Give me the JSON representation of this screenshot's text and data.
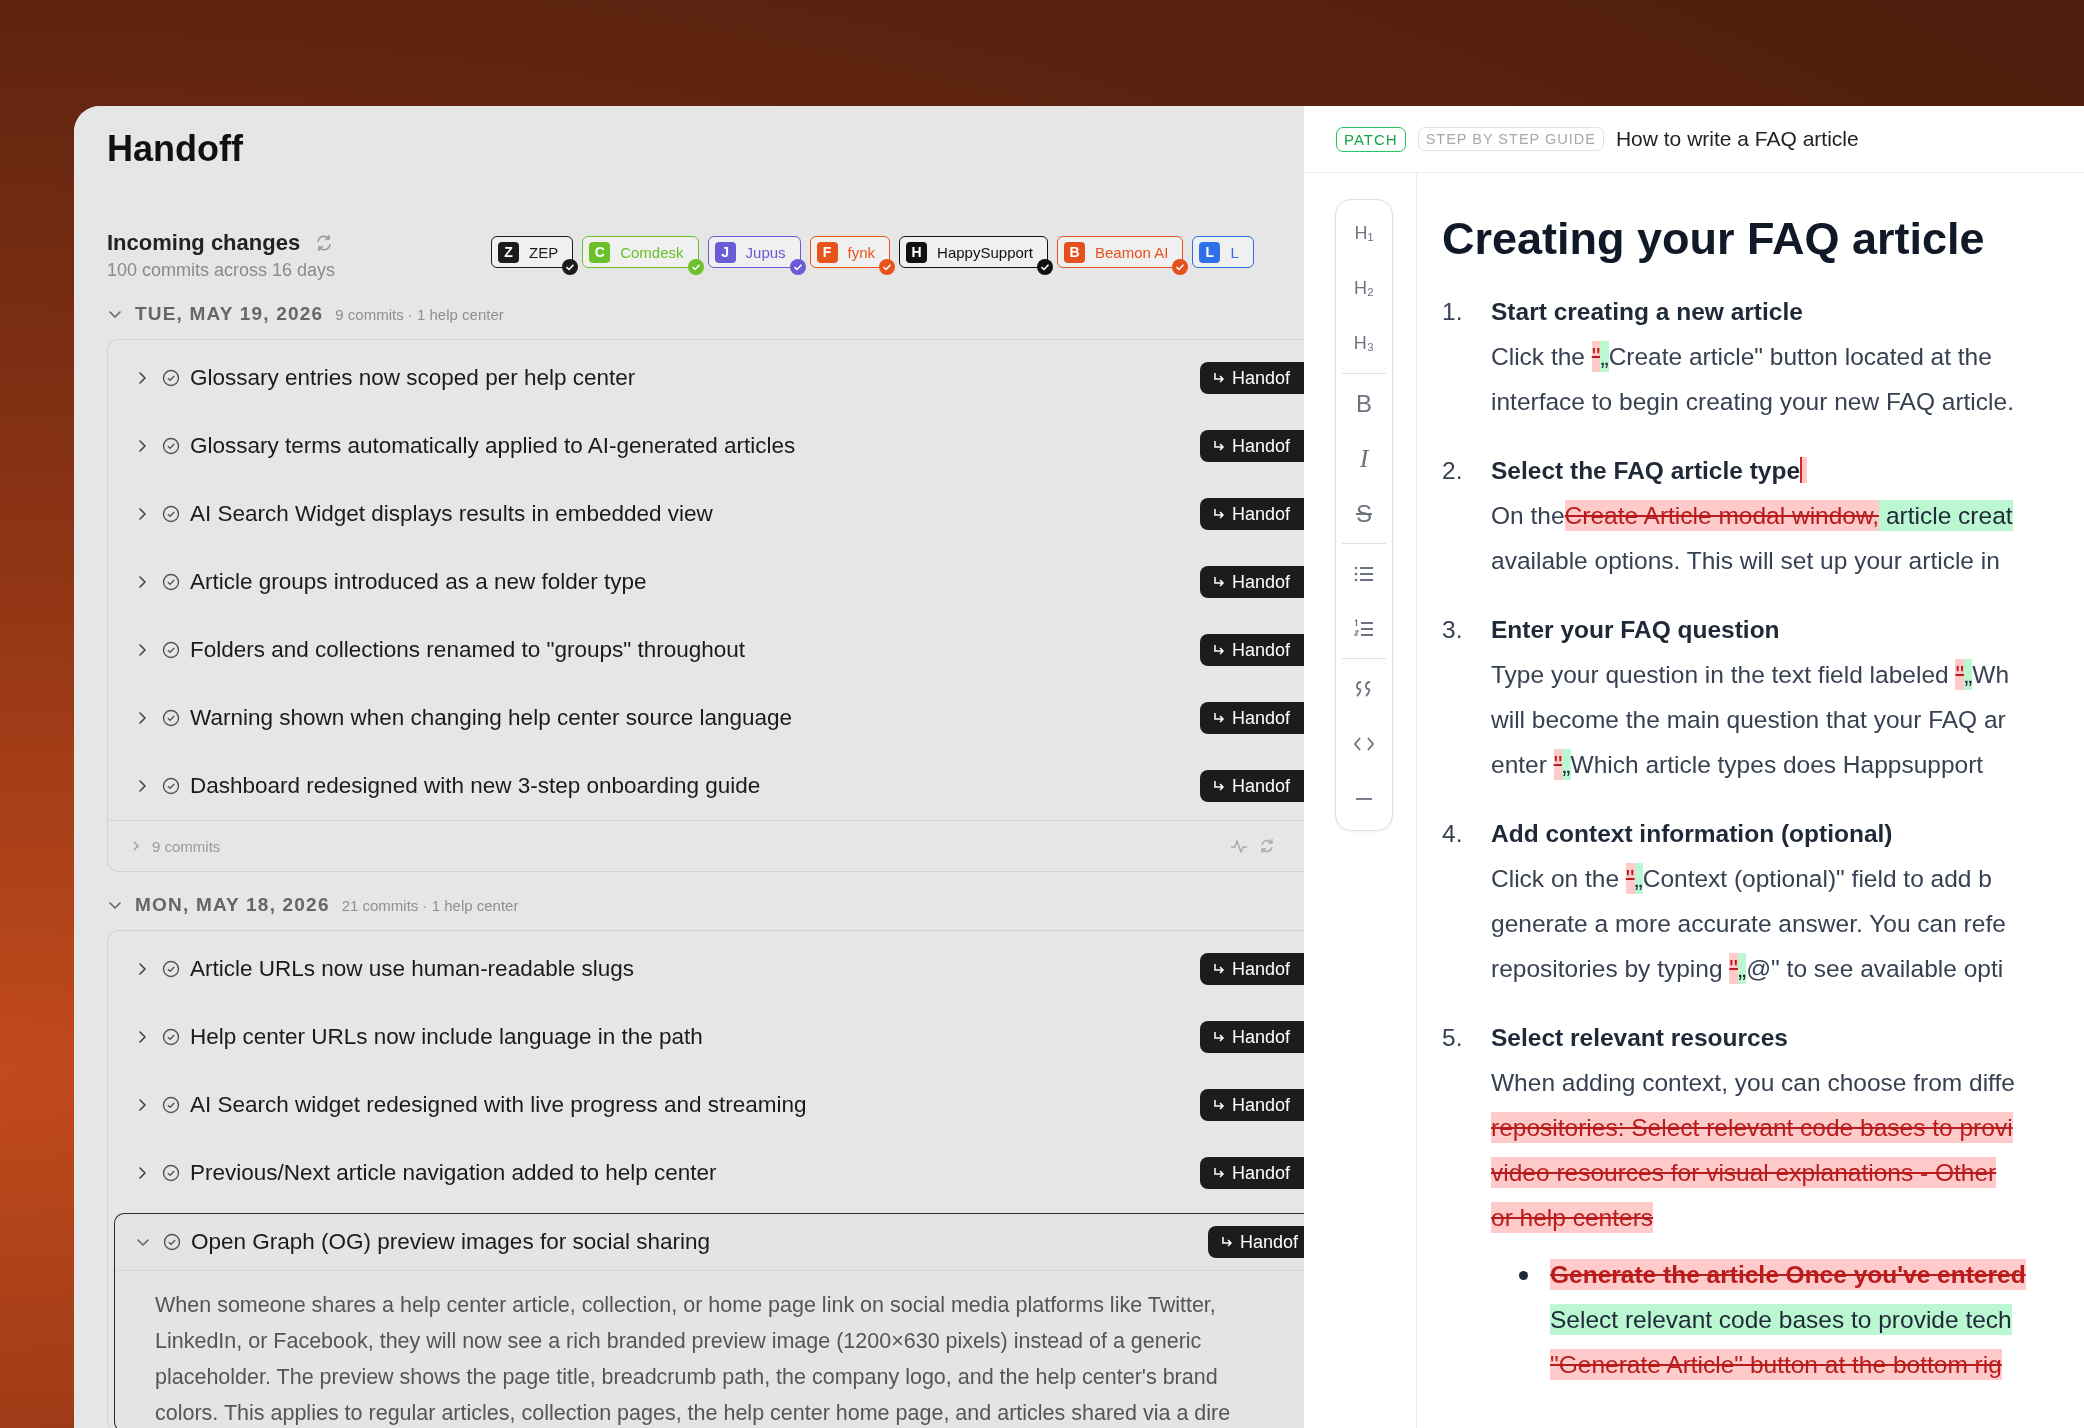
{
  "app": {
    "title": "Handoff"
  },
  "incoming": {
    "title": "Incoming changes",
    "subtitle": "100 commits across 16 days"
  },
  "sources": [
    {
      "letter": "Z",
      "name": "ZEP",
      "color": "#1c1c1c",
      "checked": true
    },
    {
      "letter": "C",
      "name": "Comdesk",
      "color": "#6cc02a",
      "checked": true
    },
    {
      "letter": "J",
      "name": "Jupus",
      "color": "#6b5bd6",
      "checked": true
    },
    {
      "letter": "F",
      "name": "fynk",
      "color": "#e8541b",
      "checked": true
    },
    {
      "letter": "H",
      "name": "HappySupport",
      "color": "#111111",
      "checked": true
    },
    {
      "letter": "B",
      "name": "Beamon AI",
      "color": "#e5501e",
      "checked": true
    },
    {
      "letter": "L",
      "name": "L",
      "color": "#2f6fe8",
      "checked": false
    }
  ],
  "days": [
    {
      "date": "TUE, MAY 19, 2026",
      "meta": "9 commits · 1 help center",
      "expanded": true,
      "commits": [
        {
          "title": "Glossary entries now scoped per help center",
          "expanded": false,
          "action": "Handof"
        },
        {
          "title": "Glossary terms automatically applied to AI-generated articles",
          "expanded": false,
          "action": "Handof"
        },
        {
          "title": "AI Search Widget displays results in embedded view",
          "expanded": false,
          "action": "Handof"
        },
        {
          "title": "Article groups introduced as a new folder type",
          "expanded": false,
          "action": "Handof"
        },
        {
          "title": "Folders and collections renamed to \"groups\" throughout",
          "expanded": false,
          "action": "Handof"
        },
        {
          "title": "Warning shown when changing help center source language",
          "expanded": false,
          "action": "Handof"
        },
        {
          "title": "Dashboard redesigned with new 3-step onboarding guide",
          "expanded": false,
          "action": "Handof"
        }
      ],
      "footer": {
        "label": "9 commits"
      }
    },
    {
      "date": "MON, MAY 18, 2026",
      "meta": "21 commits · 1 help center",
      "expanded": true,
      "commits": [
        {
          "title": "Article URLs now use human-readable slugs",
          "expanded": false,
          "action": "Handof"
        },
        {
          "title": "Help center URLs now include language in the path",
          "expanded": false,
          "action": "Handof"
        },
        {
          "title": "AI Search widget redesigned with live progress and streaming",
          "expanded": false,
          "action": "Handof"
        },
        {
          "title": "Previous/Next article navigation added to help center",
          "expanded": false,
          "action": "Handof"
        },
        {
          "title": "Open Graph (OG) preview images for social sharing",
          "expanded": true,
          "action": "Handof",
          "description_lines": [
            "When someone shares a help center article, collection, or home page link on social media platforms like Twitter,",
            "LinkedIn, or Facebook, they will now see a rich branded preview image (1200×630 pixels) instead of a generic",
            "placeholder. The preview shows the page title, breadcrumb path, the company logo, and the help center's brand",
            "colors. This applies to regular articles, collection pages, the help center home page, and articles shared via a dire"
          ]
        }
      ]
    }
  ],
  "editor": {
    "badges": [
      {
        "label": "PATCH",
        "kind": "patch"
      },
      {
        "label": "STEP BY STEP GUIDE",
        "kind": "type"
      }
    ],
    "doc_title": "How to write a FAQ article",
    "toolbar": [
      {
        "kind": "text",
        "label": "H₁",
        "divider_before": false
      },
      {
        "kind": "text",
        "label": "H₂",
        "divider_before": false
      },
      {
        "kind": "text",
        "label": "H₃",
        "divider_before": false
      },
      {
        "kind": "bold",
        "label": "B",
        "divider_before": true
      },
      {
        "kind": "italic",
        "label": "I",
        "divider_before": false
      },
      {
        "kind": "strike",
        "label": "S",
        "divider_before": false
      },
      {
        "kind": "bullet-list",
        "divider_before": true
      },
      {
        "kind": "numbered-list",
        "divider_before": false
      },
      {
        "kind": "quote",
        "divider_before": true
      },
      {
        "kind": "code",
        "divider_before": false
      },
      {
        "kind": "rule",
        "divider_before": false
      }
    ],
    "heading": "Creating your FAQ article",
    "steps": [
      {
        "number": "1.",
        "title": [
          {
            "text": "Start creating a new article",
            "kind": "plain"
          }
        ],
        "lines": [
          [
            {
              "text": "Click the ",
              "kind": "plain"
            },
            {
              "text": "\"",
              "kind": "deleted"
            },
            {
              "text": "„",
              "kind": "inserted"
            },
            {
              "text": "Create article\" button located at the",
              "kind": "plain"
            }
          ],
          [
            {
              "text": "interface to begin creating your new FAQ article.",
              "kind": "plain"
            }
          ]
        ]
      },
      {
        "number": "2.",
        "title": [
          {
            "text": "Select the FAQ article type",
            "kind": "plain"
          },
          {
            "kind": "deleted-mark"
          }
        ],
        "lines": [
          [
            {
              "text": "On the",
              "kind": "plain"
            },
            {
              "text": "Create Article modal window,",
              "kind": "deleted"
            },
            {
              "text": " article creat",
              "kind": "inserted"
            }
          ],
          [
            {
              "text": "available options. This will set up your article in",
              "kind": "plain"
            }
          ]
        ]
      },
      {
        "number": "3.",
        "title": [
          {
            "text": "Enter your FAQ question",
            "kind": "plain"
          }
        ],
        "lines": [
          [
            {
              "text": "Type your question in the text field labeled ",
              "kind": "plain"
            },
            {
              "text": "\"",
              "kind": "deleted"
            },
            {
              "text": "„",
              "kind": "inserted"
            },
            {
              "text": "Wh",
              "kind": "plain"
            }
          ],
          [
            {
              "text": "will become the main question that your FAQ ar",
              "kind": "plain"
            }
          ],
          [
            {
              "text": "enter ",
              "kind": "plain"
            },
            {
              "text": "\"",
              "kind": "deleted"
            },
            {
              "text": "„",
              "kind": "inserted"
            },
            {
              "text": "Which article types does Happsupport",
              "kind": "plain"
            }
          ]
        ]
      },
      {
        "number": "4.",
        "title": [
          {
            "text": "Add context information (optional)",
            "kind": "plain"
          }
        ],
        "lines": [
          [
            {
              "text": "Click on the ",
              "kind": "plain"
            },
            {
              "text": "\"",
              "kind": "deleted"
            },
            {
              "text": "„",
              "kind": "inserted"
            },
            {
              "text": "Context (optional)\" field to add b",
              "kind": "plain"
            }
          ],
          [
            {
              "text": "generate a more accurate answer. You can refe",
              "kind": "plain"
            }
          ],
          [
            {
              "text": "repositories by typing ",
              "kind": "plain"
            },
            {
              "text": "\"",
              "kind": "deleted"
            },
            {
              "text": "„",
              "kind": "inserted"
            },
            {
              "text": "@\" to see available opti",
              "kind": "plain"
            }
          ]
        ]
      },
      {
        "number": "5.",
        "title": [
          {
            "text": "Select relevant resources",
            "kind": "plain"
          }
        ],
        "lines": [
          [
            {
              "text": "When adding context, you can choose from diffe",
              "kind": "plain"
            }
          ],
          [
            {
              "text": "repositories: Select relevant code bases to provi",
              "kind": "deleted"
            }
          ],
          [
            {
              "text": "video resources for visual explanations - Other",
              "kind": "deleted"
            }
          ],
          [
            {
              "text": "or help centers",
              "kind": "deleted"
            }
          ]
        ],
        "bullets": [
          {
            "lines": [
              [
                {
                  "text": "Generate the article Once you've entered",
                  "kind": "deleted-bold"
                }
              ],
              [
                {
                  "text": "Select relevant code bases to provide tech",
                  "kind": "inserted"
                }
              ],
              [
                {
                  "text": "\"Generate Article\" button at the bottom rig",
                  "kind": "deleted"
                }
              ]
            ]
          }
        ]
      }
    ]
  }
}
